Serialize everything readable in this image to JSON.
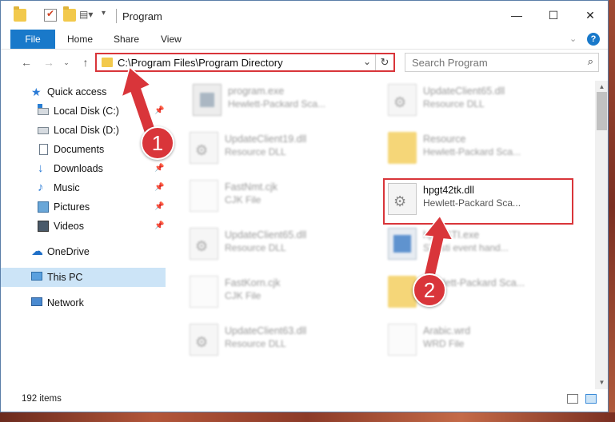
{
  "window": {
    "title": "Program",
    "controls": {
      "minimize": "—",
      "maximize": "☐",
      "close": "✕"
    }
  },
  "ribbon": {
    "tabs": [
      "File",
      "Home",
      "Share",
      "View"
    ]
  },
  "nav": {
    "address": "C:\\Program Files\\Program Directory",
    "search_placeholder": "Search Program"
  },
  "sidebar": {
    "items": [
      {
        "label": "Quick access",
        "icon": "star-icon"
      },
      {
        "label": "Local Disk (C:)",
        "icon": "drive-icon",
        "pinned": true
      },
      {
        "label": "Local Disk (D:)",
        "icon": "drive-icon"
      },
      {
        "label": "Documents",
        "icon": "documents-icon",
        "pinned": true
      },
      {
        "label": "Downloads",
        "icon": "downloads-icon",
        "pinned": true
      },
      {
        "label": "Music",
        "icon": "music-icon",
        "pinned": true
      },
      {
        "label": "Pictures",
        "icon": "pictures-icon",
        "pinned": true
      },
      {
        "label": "Videos",
        "icon": "videos-icon",
        "pinned": true
      },
      {
        "label": "OneDrive",
        "icon": "onedrive-icon"
      },
      {
        "label": "This PC",
        "icon": "this-pc-icon",
        "selected": true
      },
      {
        "label": "Network",
        "icon": "network-icon"
      }
    ]
  },
  "files": [
    {
      "name": "program.exe",
      "type": "Hewlett-Packard Sca...",
      "icon": "exe-icon"
    },
    {
      "name": "UpdateClient65.dll",
      "type": "Resource DLL",
      "icon": "dll-icon"
    },
    {
      "name": "UpdateClient19.dll",
      "type": "Resource DLL",
      "icon": "dll-icon"
    },
    {
      "name": "Resource",
      "type": "Hewlett-Packard Sca...",
      "icon": "folder-icon"
    },
    {
      "name": "FastNmt.cjk",
      "type": "CJK File",
      "icon": "document-icon"
    },
    {
      "name": "hpgt42tk.dll",
      "type": "Hewlett-Packard Sca...",
      "icon": "dll-icon",
      "highlighted": true
    },
    {
      "name": "UpdateClient65.dll",
      "type": "Resource DLL",
      "icon": "dll-icon"
    },
    {
      "name": "hpqySTI.exe",
      "type": "STI sti event hand...",
      "icon": "app-icon"
    },
    {
      "name": "FastKorn.cjk",
      "type": "CJK File",
      "icon": "document-icon"
    },
    {
      "name": "Hewlett-Packard Sca...",
      "type": "",
      "icon": "folder-icon"
    },
    {
      "name": "UpdateClient63.dll",
      "type": "Resource DLL",
      "icon": "dll-icon"
    },
    {
      "name": "Arabic.wrd",
      "type": "WRD File",
      "icon": "document-icon"
    }
  ],
  "status": {
    "count": "192 items"
  },
  "annotations": {
    "step1": "1",
    "step2": "2",
    "color": "#d9353a"
  }
}
